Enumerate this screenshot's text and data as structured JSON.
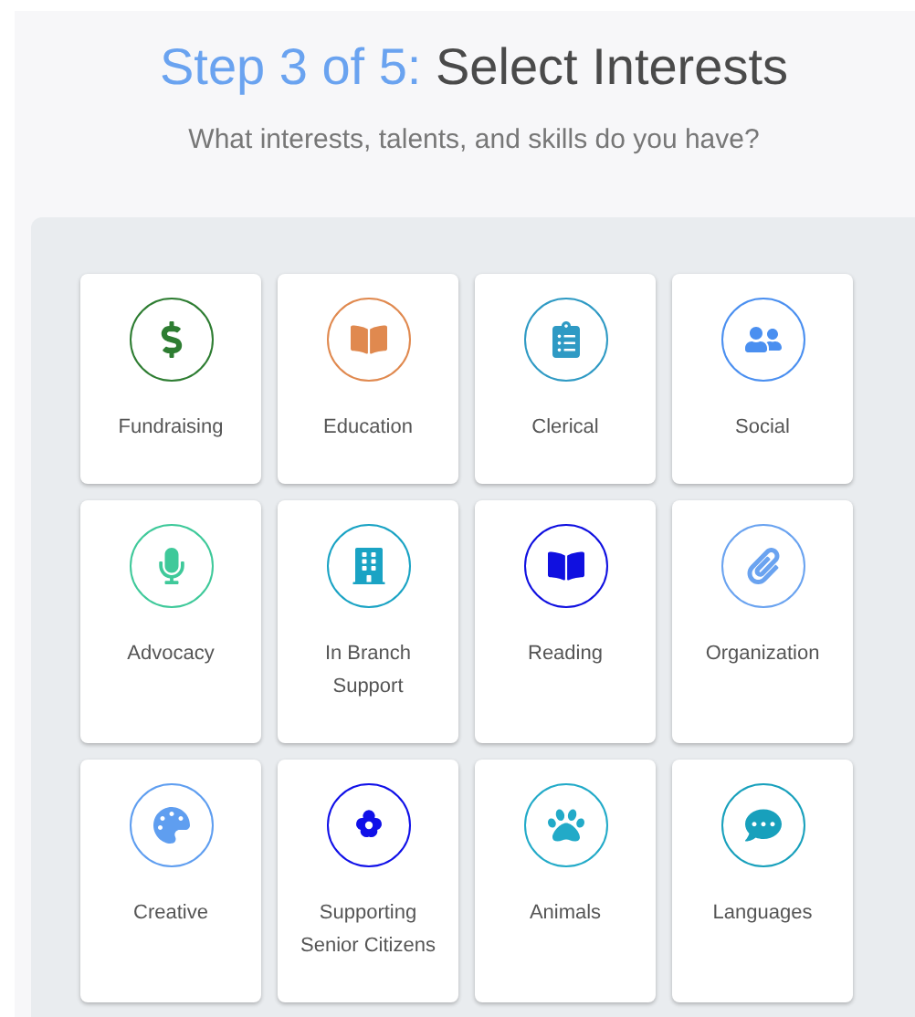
{
  "header": {
    "step": "Step 3 of 5:",
    "title": "Select Interests",
    "subtitle": "What interests, talents, and skills do you have?"
  },
  "interests": [
    {
      "label": "Fundraising",
      "color": "#2e7d32"
    },
    {
      "label": "Education",
      "color": "#e0894f"
    },
    {
      "label": "Clerical",
      "color": "#2f9ac4"
    },
    {
      "label": "Social",
      "color": "#4a8ff0"
    },
    {
      "label": "Advocacy",
      "color": "#3fc99a"
    },
    {
      "label": "In Branch Support",
      "color": "#1aa3c4"
    },
    {
      "label": "Reading",
      "color": "#1010e0"
    },
    {
      "label": "Organization",
      "color": "#6aa3f0"
    },
    {
      "label": "Creative",
      "color": "#5f9ef0"
    },
    {
      "label": "Supporting Senior Citizens",
      "color": "#1010e8"
    },
    {
      "label": "Animals",
      "color": "#22aac8"
    },
    {
      "label": "Languages",
      "color": "#18a0bc"
    }
  ]
}
